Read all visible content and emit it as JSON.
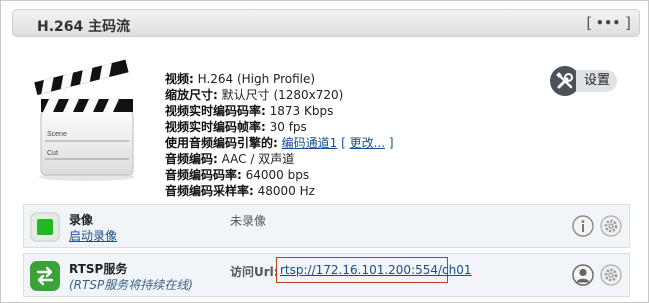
{
  "header": {
    "title": "H.264 主码流",
    "menu_label_left": "[",
    "menu_dots": "•••",
    "menu_label_right": "]"
  },
  "clapperboard": {
    "scene_label": "Scene",
    "cut_label": "Cut"
  },
  "info": [
    {
      "key": "视频:",
      "value": " H.264 (High Profile)"
    },
    {
      "key": "缩放尺寸:",
      "value": " 默认尺寸 (1280x720)"
    },
    {
      "key": "视频实时编码码率:",
      "value": " 1873 Kbps"
    },
    {
      "key": "视频实时编码帧率:",
      "value": " 30 fps"
    },
    {
      "key": "使用音频编码引擎的:",
      "value": " "
    },
    {
      "key": "音频编码:",
      "value": " AAC / 双声道"
    },
    {
      "key": "音频编码码率:",
      "value": " 64000 bps"
    },
    {
      "key": "音频编码采样率:",
      "value": " 48000 Hz"
    }
  ],
  "audio_engine": {
    "channel_link": "编码通道1",
    "bracket_open": " [ ",
    "change_link": "更改...",
    "bracket_close": " ]"
  },
  "settings": {
    "label": "设置",
    "icon": "tools-icon"
  },
  "rows": {
    "record": {
      "title": "录像",
      "subtitle": "启动录像",
      "status": "未录像",
      "icon": "record-icon",
      "accent": "#21b821"
    },
    "rtsp": {
      "title": "RTSP服务",
      "subtitle": "(RTSP服务将持续在线)",
      "url_label": "访问Url:",
      "url": "rtsp://172.16.101.200:554/ch01",
      "icon": "swap-arrows-icon",
      "accent": "#3aa236"
    }
  },
  "colors": {
    "link": "#1a4e8a",
    "highlight_border": "#c0392b",
    "row_bg": "#f1f5f9"
  }
}
